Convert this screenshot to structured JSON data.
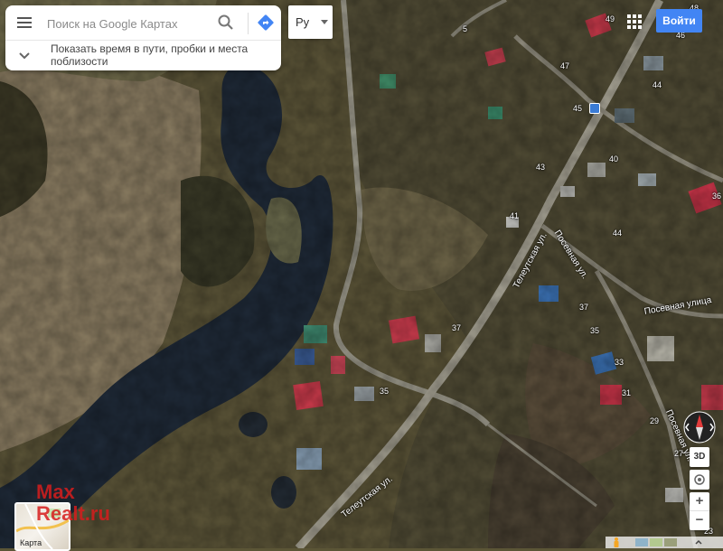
{
  "search": {
    "placeholder": "Поиск на Google Картах"
  },
  "nearby": {
    "text": "Показать время в пути, пробки и места поблизости"
  },
  "language": {
    "selected": "Ру"
  },
  "signin_label": "Войти",
  "layer_switcher": {
    "label": "Карта"
  },
  "watermark": {
    "line1": "Max",
    "line2": "Realt.ru"
  },
  "controls": {
    "three_d": "3D",
    "zoom_in": "+",
    "zoom_out": "−"
  },
  "streets": {
    "teleutskaya_1": "Телеутская ул.",
    "teleutskaya_2": "Телеутская ул.",
    "posevnaya_1": "Посевная ул.",
    "posevnaya_2": "Посевная улица",
    "posevnaya_3": "Посевная ул."
  },
  "house_numbers": {
    "n5": "5",
    "n49": "49",
    "n48": "48",
    "n46": "46",
    "n47": "47",
    "n44a": "44",
    "n45": "45",
    "n43": "43",
    "n40": "40",
    "n36": "36",
    "n41": "41",
    "n44b": "44",
    "n37a": "37",
    "n37b": "37",
    "n35a": "35",
    "n35b": "35",
    "n33": "33",
    "n31": "31",
    "n29": "29",
    "n27": "27",
    "n23": "23"
  },
  "colors": {
    "accent": "#4285f4",
    "watermark": "#d71d1d"
  },
  "icons": {
    "menu": "menu-icon",
    "search": "search-icon",
    "directions": "directions-icon",
    "chevron": "chevron-down-icon",
    "apps": "apps-grid-icon",
    "compass": "compass-icon",
    "location": "my-location-icon",
    "pegman": "pegman-icon"
  }
}
